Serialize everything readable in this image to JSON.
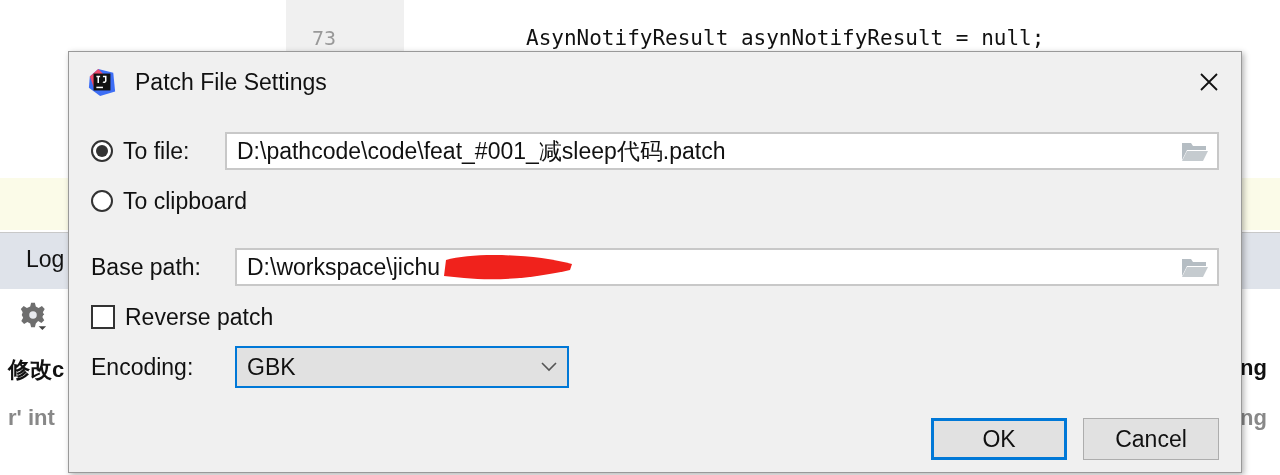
{
  "editor": {
    "line_numbers": [
      "73"
    ],
    "code_lines": [
      "AsynNotifyResult asynNotifyResult = null;"
    ]
  },
  "log_panel": {
    "tab": "Log",
    "entries": [
      {
        "text": "修改c",
        "kind": "bold"
      },
      {
        "text": "r' int",
        "kind": "muted"
      }
    ],
    "right_entries": [
      {
        "text": "ng",
        "kind": "bold"
      },
      {
        "text": "ng",
        "kind": "muted"
      }
    ]
  },
  "dialog": {
    "title": "Patch File Settings",
    "destination": [
      {
        "label": "To file:",
        "selected": true,
        "value": "D:\\pathcode\\code\\feat_#001_减sleep代码.patch"
      },
      {
        "label": "To clipboard",
        "selected": false
      }
    ],
    "base_path": {
      "label": "Base path:",
      "value": "D:\\workspace\\jichu"
    },
    "reverse_patch": {
      "label": "Reverse patch",
      "checked": false
    },
    "encoding": {
      "label": "Encoding:",
      "value": "GBK"
    },
    "buttons": [
      {
        "label": "OK",
        "default": true
      },
      {
        "label": "Cancel",
        "default": false
      }
    ]
  }
}
